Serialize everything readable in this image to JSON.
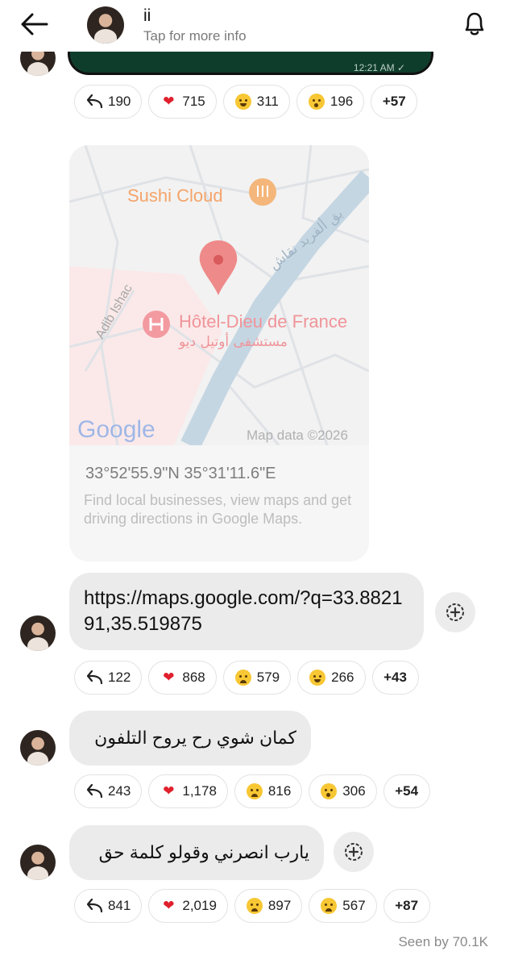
{
  "header": {
    "title": "ii",
    "subtitle": "Tap for more info"
  },
  "previous_message": {
    "time": "12:21 AM ✓"
  },
  "reactions": [
    {
      "reply": "190",
      "items": [
        {
          "icon": "heart",
          "count": "715"
        },
        {
          "icon": "grin",
          "count": "311"
        },
        {
          "icon": "wow",
          "count": "196"
        }
      ],
      "more": "+57"
    },
    {
      "reply": "122",
      "items": [
        {
          "icon": "heart",
          "count": "868"
        },
        {
          "icon": "cry",
          "count": "579"
        },
        {
          "icon": "grin",
          "count": "266"
        }
      ],
      "more": "+43"
    },
    {
      "reply": "243",
      "items": [
        {
          "icon": "heart",
          "count": "1,178"
        },
        {
          "icon": "cry",
          "count": "816"
        },
        {
          "icon": "wow",
          "count": "306"
        }
      ],
      "more": "+54"
    },
    {
      "reply": "841",
      "items": [
        {
          "icon": "heart",
          "count": "2,019"
        },
        {
          "icon": "cry",
          "count": "897"
        },
        {
          "icon": "cry",
          "count": "567"
        }
      ],
      "more": "+87"
    }
  ],
  "map": {
    "labels": {
      "sushi": "Sushi Cloud",
      "street_ar": "بق ألفريد نقاش",
      "adib": "Adib Ishac",
      "hotel": "Hôtel-Dieu de France",
      "hotel_ar": "مستشفى أوتيل ديو",
      "google": "Google",
      "copyright": "Map data ©2026"
    },
    "coords": "33°52'55.9\"N 35°31'11.6\"E",
    "description": "Find local businesses, view maps and get driving directions in Google Maps."
  },
  "messages": {
    "link": "https://maps.google.com/?q=33.882191,35.519875",
    "ar1": "كمان شوي رح يروح التلفون",
    "ar2": "يارب انصرني وقولو كلمة حق"
  },
  "seen": "Seen by 70.1K",
  "colors": {
    "accent_red": "#e0202c",
    "bubble_gray": "#ebebeb",
    "prev_bubble": "#0f3d2b"
  }
}
